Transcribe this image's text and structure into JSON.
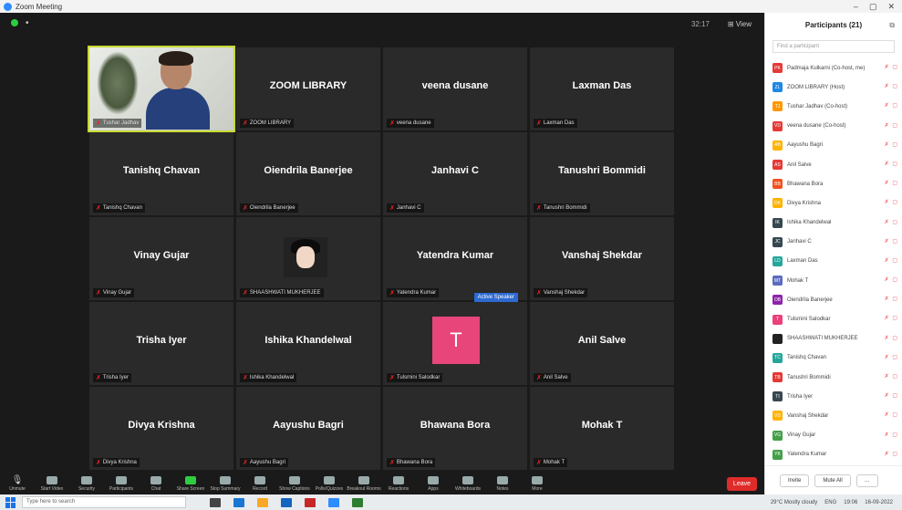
{
  "window": {
    "title": "Zoom Meeting",
    "controls": [
      "–",
      "▢",
      "✕"
    ]
  },
  "meeting": {
    "time": "32:17",
    "view_label": "⊞ View",
    "tiles": [
      {
        "big": "",
        "label": "Tushar Jadhav",
        "type": "camera"
      },
      {
        "big": "ZOOM LIBRARY",
        "label": "ZOOM LIBRARY"
      },
      {
        "big": "veena dusane",
        "label": "veena dusane"
      },
      {
        "big": "Laxman Das",
        "label": "Laxman Das"
      },
      {
        "big": "Tanishq Chavan",
        "label": "Tanishq Chavan"
      },
      {
        "big": "Oiendrila Banerjee",
        "label": "Oiendrila Banerjee"
      },
      {
        "big": "Janhavi C",
        "label": "Janhavi C"
      },
      {
        "big": "Tanushri Bommidi",
        "label": "Tanushri Bommidi"
      },
      {
        "big": "Vinay Gujar",
        "label": "Vinay Gujar"
      },
      {
        "big": "",
        "label": "SHAASHWATI MUKHERJEE",
        "type": "avatar"
      },
      {
        "big": "Yatendra Kumar",
        "label": "Yatendra Kumar"
      },
      {
        "big": "Vanshaj Shekdar",
        "label": "Vanshaj Shekdar"
      },
      {
        "big": "Trisha Iyer",
        "label": "Trisha Iyer"
      },
      {
        "big": "Ishika Khandelwal",
        "label": "Ishika Khandelwal"
      },
      {
        "big": "",
        "label": "Tulsmini Salodkar",
        "type": "letter",
        "letter": "T",
        "tag": "Active Speaker"
      },
      {
        "big": "Anil Salve",
        "label": "Anil Salve"
      },
      {
        "big": "Divya Krishna",
        "label": "Divya Krishna"
      },
      {
        "big": "Aayushu Bagri",
        "label": "Aayushu Bagri"
      },
      {
        "big": "Bhawana Bora",
        "label": "Bhawana Bora"
      },
      {
        "big": "Mohak T",
        "label": "Mohak T"
      }
    ]
  },
  "toolbar": {
    "items": [
      "Unmute",
      "Start Video",
      "Security",
      "Participants",
      "Chat",
      "Share Screen",
      "Stop Summary",
      "Record",
      "Show Captions",
      "Polls/Quizzes",
      "Breakout Rooms",
      "Reactions",
      "Apps",
      "Whiteboards",
      "Notes",
      "More"
    ],
    "participants_count": "21",
    "leave": "Leave"
  },
  "panel": {
    "title": "Participants (21)",
    "search_placeholder": "Find a participant",
    "participants": [
      {
        "name": "Padmaja Kulkarni (Co-host, me)",
        "initials": "PK",
        "color": "#e53935"
      },
      {
        "name": "ZOOM LIBRARY (Host)",
        "initials": "ZL",
        "color": "#1e88e5"
      },
      {
        "name": "Tushar Jadhav (Co-host)",
        "initials": "TJ",
        "color": "#ff9800"
      },
      {
        "name": "veena dusane (Co-host)",
        "initials": "VD",
        "color": "#e53935"
      },
      {
        "name": "Aayushu Bagri",
        "initials": "AB",
        "color": "#ffb300"
      },
      {
        "name": "Anil Salve",
        "initials": "AS",
        "color": "#e53935"
      },
      {
        "name": "Bhawana Bora",
        "initials": "BB",
        "color": "#f4511e"
      },
      {
        "name": "Divya Krishna",
        "initials": "DK",
        "color": "#ffb300"
      },
      {
        "name": "Ishika Khandelwal",
        "initials": "IK",
        "color": "#37474f"
      },
      {
        "name": "Janhavi C",
        "initials": "JC",
        "color": "#37474f"
      },
      {
        "name": "Laxman Das",
        "initials": "LD",
        "color": "#26a69a"
      },
      {
        "name": "Mohak T",
        "initials": "MT",
        "color": "#5c6bc0"
      },
      {
        "name": "Oiendrila Banerjee",
        "initials": "OB",
        "color": "#8e24aa"
      },
      {
        "name": "Tulsmini Salodkar",
        "initials": "T",
        "color": "#ec407a"
      },
      {
        "name": "SHAASHWATI MUKHERJEE",
        "initials": "",
        "color": "#222222"
      },
      {
        "name": "Tanishq Chavan",
        "initials": "TC",
        "color": "#26a69a"
      },
      {
        "name": "Tanushri Bommidi",
        "initials": "TB",
        "color": "#e53935"
      },
      {
        "name": "Trisha Iyer",
        "initials": "TI",
        "color": "#37474f"
      },
      {
        "name": "Vanshaj Shekdar",
        "initials": "VS",
        "color": "#ffb300"
      },
      {
        "name": "Vinay Gujar",
        "initials": "VG",
        "color": "#43a047"
      },
      {
        "name": "Yatendra Kumar",
        "initials": "YK",
        "color": "#43a047"
      }
    ],
    "invite": "Invite",
    "mute_all": "Mute All"
  },
  "taskbar": {
    "search_placeholder": "Type here to search",
    "weather": "29°C Mostly cloudy",
    "lang": "ENG",
    "time": "19:06",
    "date": "16-09-2022"
  }
}
